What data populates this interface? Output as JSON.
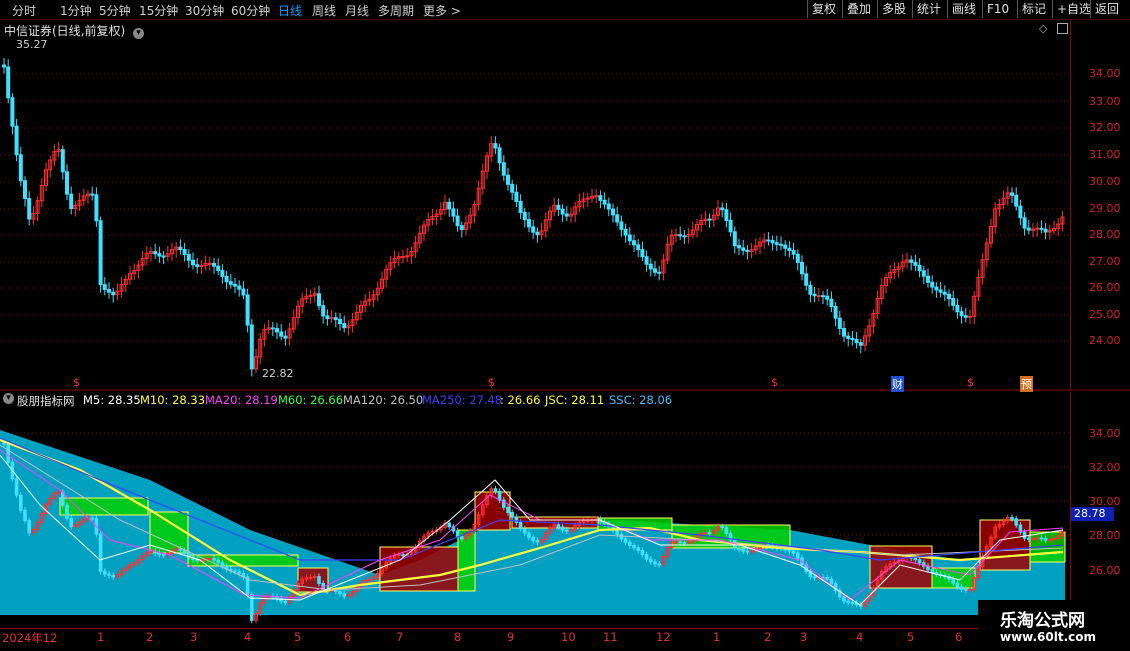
{
  "toolbar": {
    "periods": [
      "分时",
      "1分钟",
      "5分钟",
      "15分钟",
      "30分钟",
      "60分钟",
      "日线",
      "周线",
      "月线",
      "多周期",
      "更多 >"
    ],
    "active_period": "日线",
    "buttons": [
      "复权",
      "叠加",
      "多股",
      "统计",
      "画线",
      "F10",
      "标记",
      "+自选",
      "返回"
    ]
  },
  "main_panel": {
    "title": "中信证券(日线,前复权)",
    "high_label": "35.27",
    "low_label": "22.82",
    "y_ticks": [
      "34.00",
      "33.00",
      "32.00",
      "31.00",
      "30.00",
      "29.00",
      "28.00",
      "27.00",
      "26.00",
      "25.00",
      "24.00"
    ],
    "markers": [
      "$",
      "$",
      "$",
      "财",
      "$",
      "预"
    ],
    "colors": {
      "up": "#ff3030",
      "down": "#40e0ff",
      "grid": "#8b0000",
      "tick": "#d02020"
    }
  },
  "indicator_panel": {
    "name": "股朋指标网",
    "values": [
      {
        "label": "M5: 28.35",
        "color": "#ffffff"
      },
      {
        "label": "M10: 28.33",
        "color": "#ffff40"
      },
      {
        "label": "MA20: 28.19",
        "color": "#ff40ff"
      },
      {
        "label": "M60: 26.66",
        "color": "#40ff40"
      },
      {
        "label": "MA120: 26.50",
        "color": "#c0c0c0"
      },
      {
        "label": "MA250: 27.48",
        "color": "#4040ff"
      },
      {
        "label": ": 26.66",
        "color": "#ffff40"
      },
      {
        "label": "JSC: 28.11",
        "color": "#ffff40"
      },
      {
        "label": "SSC: 28.06",
        "color": "#40c0ff"
      }
    ],
    "y_ticks": [
      "34.00",
      "32.00",
      "30.00",
      "28.00",
      "26.00"
    ],
    "current_price": "28.78",
    "colors": {
      "fill": "#00a0c0",
      "box_up": "#a00000",
      "box_down": "#00d000"
    }
  },
  "date_axis": [
    "2024年12",
    "1",
    "2",
    "3",
    "4",
    "5",
    "6",
    "7",
    "8",
    "9",
    "10",
    "11",
    "12",
    "1",
    "2",
    "3",
    "4",
    "5",
    "6"
  ],
  "watermark": {
    "name": "乐淘公式网",
    "url": "www.60lt.com"
  }
}
